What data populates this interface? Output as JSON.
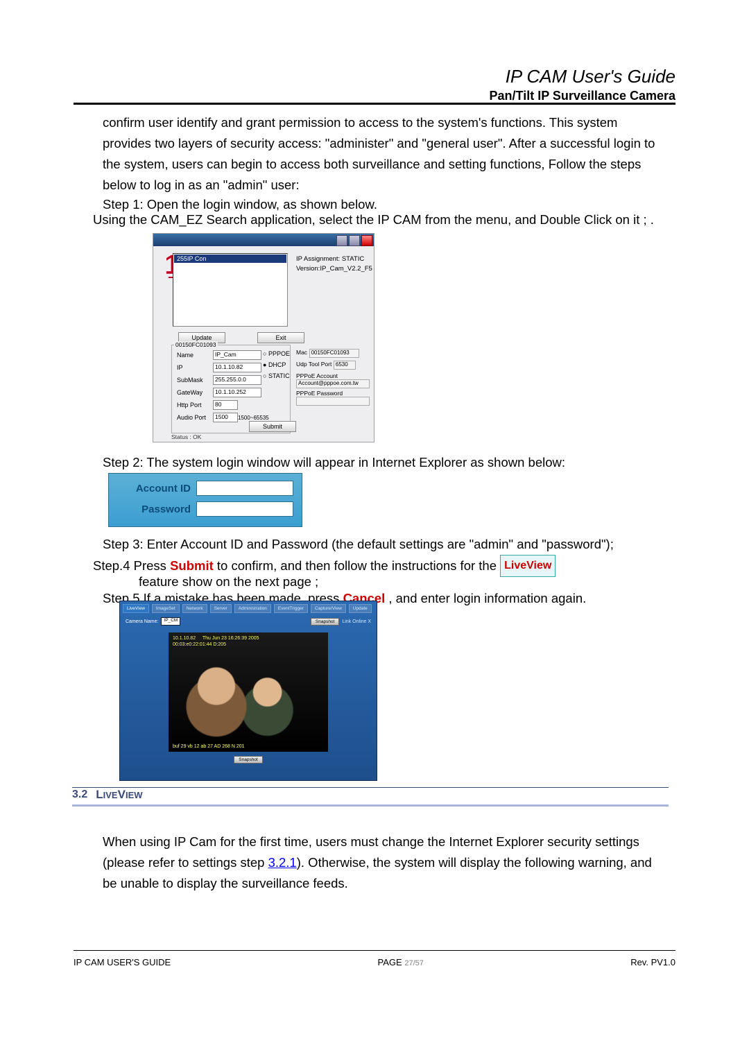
{
  "header": {
    "title": "IP CAM User's Guide",
    "subtitle": "Pan/Tilt IP Surveillance Camera"
  },
  "body": {
    "p1": "confirm user identify and grant permission to access to the system's functions. This system provides two layers of security access: \"administer\" and \"general user\". After a successful login to the system, users can begin to access both surveillance and setting functions, Follow the steps below to log in as an \"admin\" user:",
    "step1": "Step 1: Open the login window, as shown below.",
    "usingcam": "Using the CAM_EZ Search application, select the IP CAM from the menu, and Double Click on it ;  .",
    "step2": "Step 2: The system login window will appear in Internet Explorer as shown below:",
    "step3": "Step 3: Enter Account ID and Password (the default settings are \"admin\" and \"password\");",
    "step4_pre": "Step.4     Press ",
    "step4_submit": "Submit",
    "step4_mid": " to confirm, and then follow the instructions for the ",
    "step4_badge": "LiveView",
    "step4_line2": "feature show on the next page ;",
    "step5_pre": "Step.5   If a mistake has been made, press ",
    "step5_cancel": "Cancel",
    "step5_post": " , and enter login information again."
  },
  "fig1": {
    "list_item": "255IP Con",
    "ipassign": "IP Assignment: STATIC",
    "version": "Version:IP_Cam_V2.2_F5",
    "btn_update": "Update",
    "btn_exit": "Exit",
    "btn_submit": "Submit",
    "group_legend": "00150FC01093",
    "labels": {
      "name": "Name",
      "ip": "IP",
      "submask": "SubMask",
      "gateway": "GateWay",
      "httpport": "Http Port",
      "audioport": "Audio Port"
    },
    "values": {
      "name": "IP_Cam",
      "ip": "10.1.10.82",
      "submask": "255.255.0.0",
      "gateway": "10.1.10.252",
      "httpport": "80",
      "audioport": "1500"
    },
    "audioport_hint": "1500~65535",
    "radios": {
      "pppoe": "PPPOE",
      "dhcp": "DHCP",
      "static": "STATIC"
    },
    "status": "Status :   OK",
    "right": {
      "mac_lbl": "Mac",
      "mac_val": "00150FC01093",
      "udp_lbl": "Udp Tool Port",
      "udp_val": "6530",
      "pppoe_acc_lbl": "PPPoE Account",
      "pppoe_acc_val": "Account@pppoe.com.tw",
      "pppoe_pw_lbl": "PPPoE Password"
    }
  },
  "fig2": {
    "account": "Account ID",
    "password": "Password"
  },
  "fig3": {
    "tabs": [
      "LiveView",
      "ImageSet",
      "Network",
      "Server",
      "Administration",
      "EventTrigger",
      "Capture/View",
      "Update"
    ],
    "camname_lbl": "Camera Name:",
    "camname_val": "IP_CM",
    "snapshot_btn": "Snapshot",
    "link_lbl": "Link Online X",
    "overlay1": "10.1.10.82",
    "overlay2": "Thu Jun 23 16:26:39 2005",
    "overlay3": "00:03:e0:22:01:44 D:205",
    "overlay4": "buf 29 vb 12 ab 27 AD 268 N 201",
    "snap2": "Snapshot"
  },
  "sec32": {
    "num": "3.2",
    "title_pre": "L",
    "title_rest": "IVE",
    "title2_pre": "V",
    "title2_rest": "IEW",
    "body_pre": "When using IP Cam for the first time, users must change the Internet Explorer security settings (please refer to settings step ",
    "link": "3.2.1",
    "body_post": "). Otherwise, the system will display the following warning, and be unable to display the surveillance feeds."
  },
  "footer": {
    "left": "IP CAM USER'S GUIDE",
    "page_lbl": "PAGE ",
    "page_num": "27/57",
    "right": "Rev. PV1.0"
  }
}
